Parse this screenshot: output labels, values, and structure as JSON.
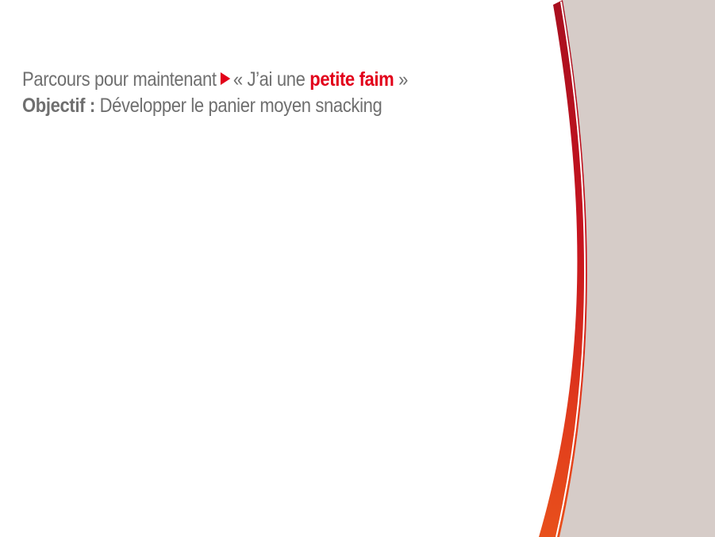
{
  "title": {
    "prefix": "Parcours pour maintenant",
    "arrow_icon": "triangle-right-icon",
    "quote_open": "« J’ai une",
    "highlight": "petite faim",
    "quote_close": "»"
  },
  "objective": {
    "label": "Objectif :",
    "text": "Développer le panier moyen snacking"
  },
  "colors": {
    "accent": "#e2001a",
    "text_gray": "#6f6f6f",
    "side_panel": "#d6ccc8",
    "curve_top": "#b5121b",
    "curve_bottom": "#e8461e"
  }
}
